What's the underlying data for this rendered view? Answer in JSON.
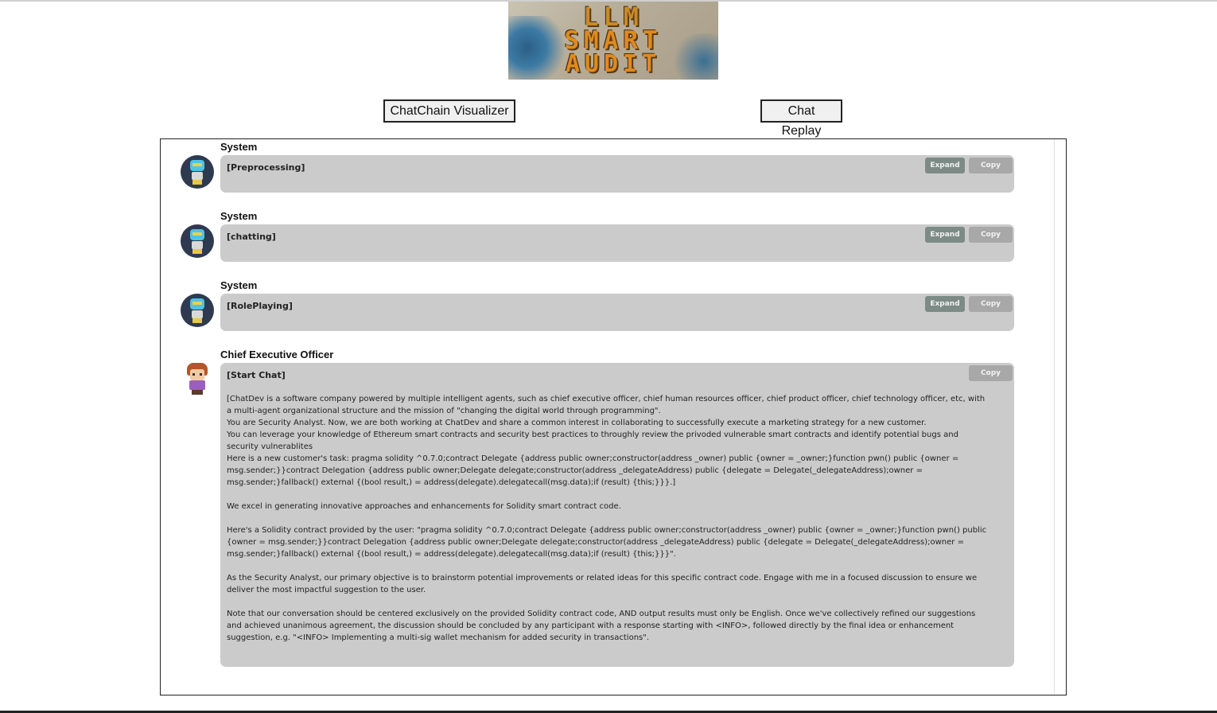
{
  "logo": {
    "line1": "LLM",
    "line2": "SMART",
    "line3": "AUDIT"
  },
  "nav": {
    "visualizer_label": "ChatChain Visualizer",
    "replay_label": "Chat Replay"
  },
  "buttons": {
    "expand": "Expand",
    "copy": "Copy"
  },
  "messages": [
    {
      "role": "System",
      "tag": "[Preprocessing]",
      "avatar": "robot-icon"
    },
    {
      "role": "System",
      "tag": "[chatting]",
      "avatar": "robot-icon"
    },
    {
      "role": "System",
      "tag": "[RolePlaying]",
      "avatar": "robot-icon"
    },
    {
      "role": "Chief Executive Officer",
      "tag": "[Start Chat]",
      "avatar": "ceo-avatar-icon",
      "body": "[ChatDev is a software company powered by multiple intelligent agents, such as chief executive officer, chief human resources officer, chief product officer, chief technology officer, etc, with a multi-agent organizational structure and the mission of \"changing the digital world through programming\".\nYou are Security Analyst. Now, we are both working at ChatDev and share a common interest in collaborating to successfully execute a marketing strategy for a new customer.\nYou can leverage your knowledge of Ethereum smart contracts and security best practices to throughly review the privoded vulnerable smart contracts and identify potential bugs and security vulnerablites\nHere is a new customer's task: pragma solidity ^0.7.0;contract Delegate {address public owner;constructor(address _owner) public {owner = _owner;}function pwn() public {owner = msg.sender;}}contract Delegation {address public owner;Delegate delegate;constructor(address _delegateAddress) public {delegate = Delegate(_delegateAddress);owner = msg.sender;}fallback() external {(bool result,) = address(delegate).delegatecall(msg.data);if (result) {this;}}}.]\n\nWe excel in generating innovative approaches and enhancements for Solidity smart contract code.\n\nHere's a Solidity contract provided by the user: \"pragma solidity ^0.7.0;contract Delegate {address public owner;constructor(address _owner) public {owner = _owner;}function pwn() public {owner = msg.sender;}}contract Delegation {address public owner;Delegate delegate;constructor(address _delegateAddress) public {delegate = Delegate(_delegateAddress);owner = msg.sender;}fallback() external {(bool result,) = address(delegate).delegatecall(msg.data);if (result) {this;}}}\".\n\nAs the Security Analyst, our primary objective is to brainstorm potential improvements or related ideas for this specific contract code. Engage with me in a focused discussion to ensure we deliver the most impactful suggestion to the user.\n\nNote that our conversation should be centered exclusively on the provided Solidity contract code, AND output results must only be English. Once we've collectively refined our suggestions and achieved unanimous agreement, the discussion should be concluded by any participant with a response starting with <INFO>, followed directly by the final idea or enhancement suggestion, e.g. \"<INFO> Implementing a multi-sig wallet mechanism for added security in transactions\"."
    }
  ]
}
